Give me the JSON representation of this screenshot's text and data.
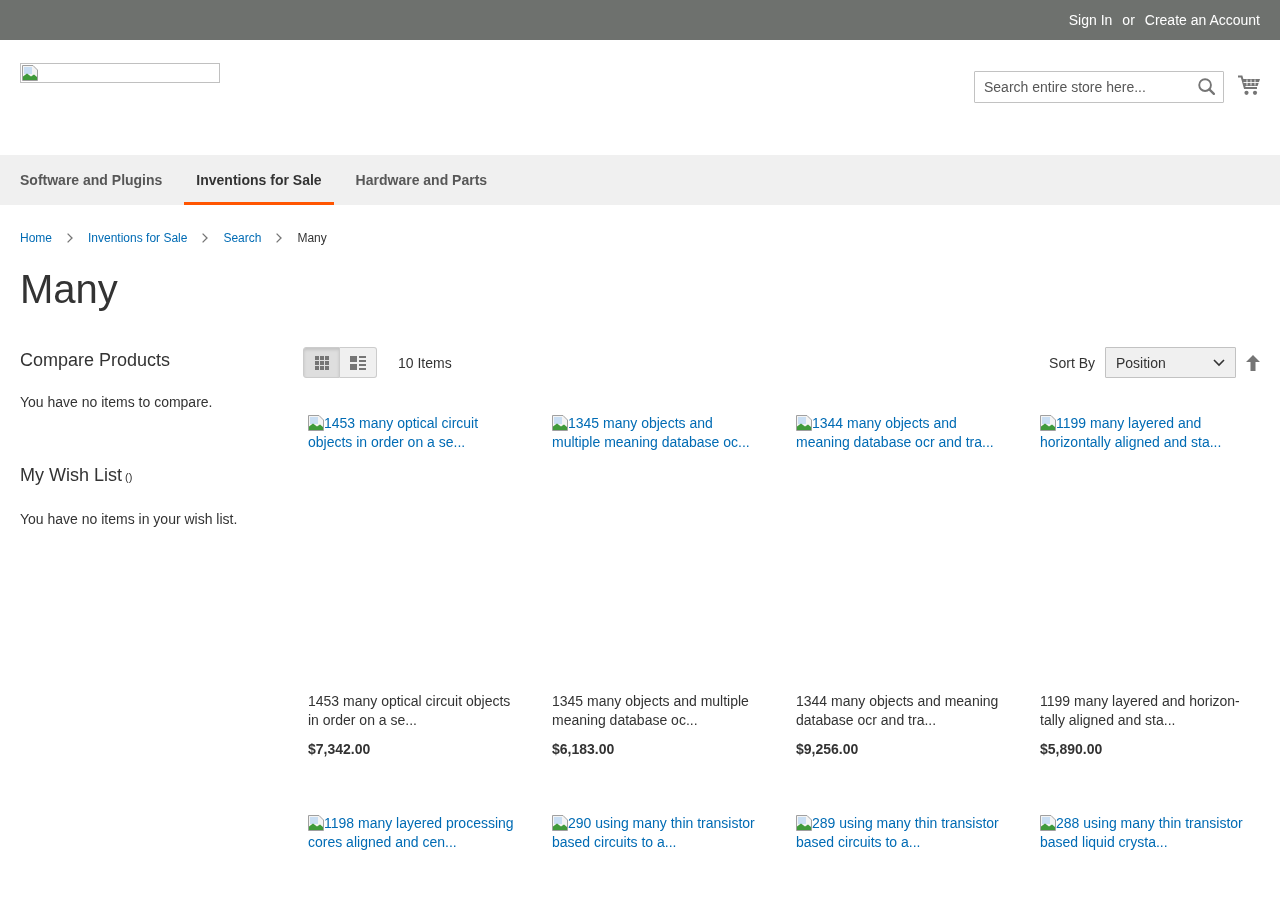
{
  "top_bar": {
    "links": [
      "Sign In",
      "Create an Account"
    ],
    "separator": "or"
  },
  "header": {
    "search": {
      "placeholder": "Search entire store here..."
    }
  },
  "nav": [
    {
      "label": "Software and Plugins",
      "selected": false
    },
    {
      "label": "Inventions for Sale",
      "selected": true
    },
    {
      "label": "Hardware and Parts",
      "selected": false
    }
  ],
  "breadcrumbs": [
    {
      "label": "Home",
      "current": false
    },
    {
      "label": "Inventions for Sale",
      "current": false
    },
    {
      "label": "Search",
      "current": false
    },
    {
      "label": "Many",
      "current": true
    }
  ],
  "page_title": "Many",
  "sidebar": {
    "compare": {
      "title": "Compare Products",
      "message": "You have no items to compare."
    },
    "wishlist": {
      "title": "My Wish List",
      "counter": "()",
      "message": "You have no items in your wish list."
    }
  },
  "toolbar": {
    "view_modes": [
      {
        "kind": "grid",
        "selected": true
      },
      {
        "kind": "list",
        "selected": false
      }
    ],
    "item_count": "10 Items",
    "sort": {
      "label": "Sort By",
      "value": "Position"
    }
  },
  "products": [
    {
      "image_alt": "1453 many optical circuit objects in order on a se...",
      "name": "1453 many optical circuit objects in order on a se...",
      "price": "$7,342.00"
    },
    {
      "image_alt": "1345 many objects and multiple meaning database oc...",
      "name": "1345 many objects and multiple meaning database oc...",
      "price": "$6,183.00"
    },
    {
      "image_alt": "1344 many objects and meaning database ocr and tra...",
      "name": "1344 many objects and meaning database ocr and tra...",
      "price": "$9,256.00"
    },
    {
      "image_alt": "1199 many layered and horizontally aligned and sta...",
      "name": "1199 many layered and horizon-tally aligned and sta...",
      "price": "$5,890.00"
    },
    {
      "image_alt": "1198 many layered processing cores aligned and cen..."
    },
    {
      "image_alt": "290 using many thin transistor based circuits to a..."
    },
    {
      "image_alt": "289 using many thin transistor based circuits to a..."
    },
    {
      "image_alt": "288 using many thin transistor based liquid crysta..."
    }
  ]
}
